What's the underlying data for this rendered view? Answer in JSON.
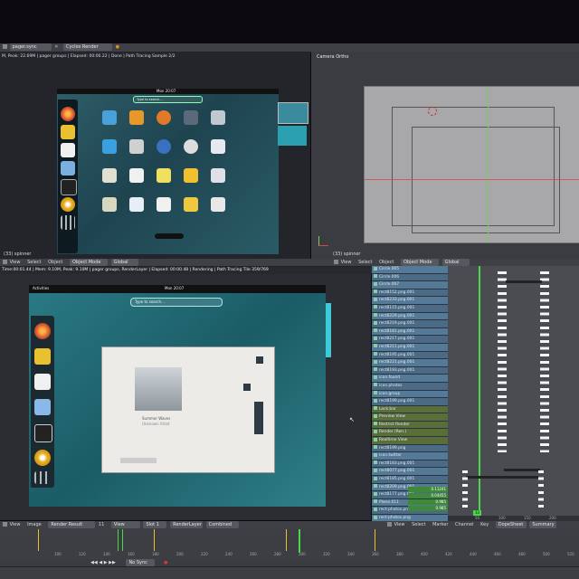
{
  "top_header": {
    "scene_label": "pager.sync",
    "engine_label": "Cycles Render",
    "status_text": "M, Peak: 22.69M | pager groups | Elapsed: 00:00.22 | Done | Path Tracing Sample 2/2"
  },
  "left_viewport": {
    "gnome": {
      "clock": "Mon 20:07",
      "search_placeholder": "Type to search..."
    },
    "bottom_label": "(33) spinner"
  },
  "right_viewport": {
    "title": "Camera Ortho",
    "bottom_label": "(33) spinner"
  },
  "mid_header": {
    "items": [
      "View",
      "Select",
      "Object",
      "Object Mode",
      "Global"
    ]
  },
  "render_status": "Time:00:01.44 | Mem: 9.10M, Peak: 9.10M | pager groups, RenderLayer | Elapsed: 00:00.48 | Rendering | Path Tracing Tile 359/769",
  "right_header": {
    "items": [
      "View",
      "Select",
      "Object",
      "Object Mode",
      "Global"
    ]
  },
  "render_view": {
    "gnome": {
      "activities": "Activities",
      "clock": "Mon 20:07",
      "search_placeholder": "Type to search..."
    },
    "player": {
      "title": "Summer Waves",
      "artist": "Unknown Artist"
    }
  },
  "outliner": {
    "rows": [
      "Circle.005",
      "Circle.006",
      "Circle.007",
      "rect8152.png.001",
      "rect8233.png.001",
      "rect8115.png.001",
      "rect8229.png.001",
      "rect8219.png.001",
      "rect8181.png.001",
      "rect8217.png.001",
      "rect8211.png.001",
      "rect8195.png.001",
      "rect8221.png.001",
      "rect8193.png.001",
      "icon.found",
      "icon.photos",
      "icon.group",
      "rect8199.png.001",
      "Lock.bar",
      "Preview View",
      "Restrict Render",
      "Render (Ren.)",
      "Realtime View",
      "rect8199.png",
      "icon.twitter",
      "rect8183.png.001",
      "rect8077.png.001",
      "rect8185.png.001",
      "rect8209.png.001",
      "rect8177.png.001",
      "Plane.011",
      "rect-photos.png.001",
      "rect-photos.png",
      "Lock.bar"
    ],
    "values": [
      "0.11241",
      "0.04455",
      "0.985",
      "0.985"
    ]
  },
  "dopesheet": {
    "ticks": [
      "50",
      "100",
      "150",
      "200"
    ],
    "header": [
      "View",
      "Select",
      "Marker",
      "Channel",
      "Key",
      "DopeSheet",
      "Summary"
    ],
    "current_frame": "33"
  },
  "bottom_header": {
    "items": [
      "View",
      "Image",
      "Render Result",
      "View",
      "Slot 1",
      "RenderLayer",
      "Combined"
    ],
    "slot_number": "11"
  },
  "timeline": {
    "ticks": [
      "100",
      "120",
      "140",
      "160",
      "180",
      "200",
      "220",
      "240",
      "260",
      "280",
      "300",
      "320",
      "340",
      "360",
      "380",
      "400",
      "420",
      "440",
      "460",
      "480",
      "500",
      "520"
    ],
    "sync": "No Sync"
  }
}
